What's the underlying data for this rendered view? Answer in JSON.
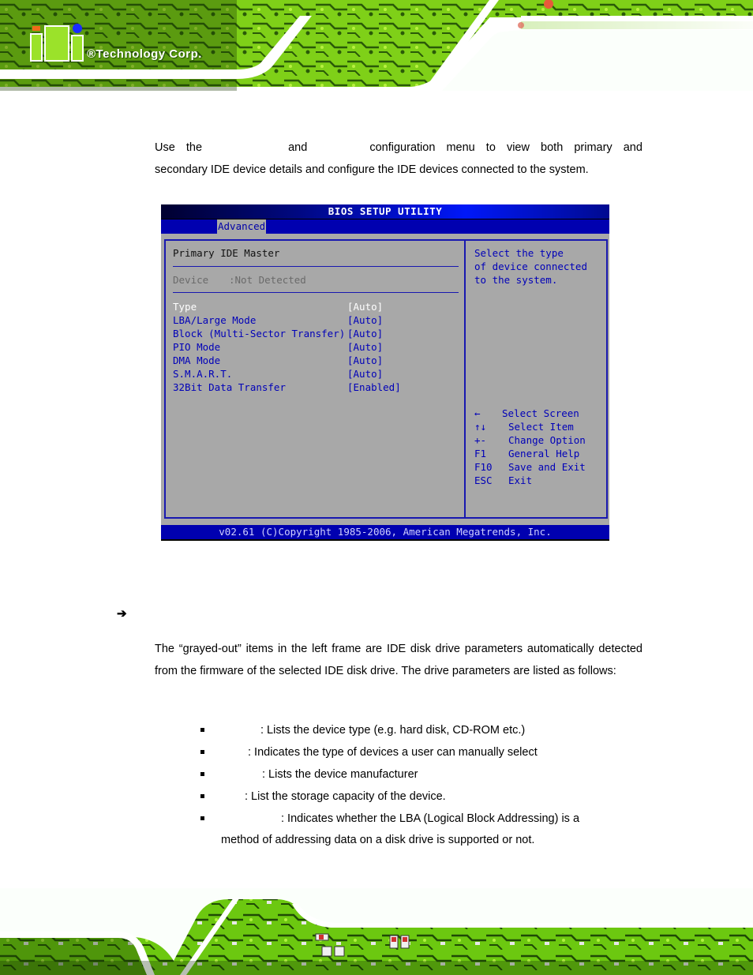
{
  "header": {
    "logo_text": "®Technology Corp."
  },
  "intro": {
    "line1_words": [
      "Use",
      "the",
      "and",
      "configuration",
      "menu",
      "to",
      "view",
      "both",
      "primary",
      "and"
    ],
    "line2": "secondary IDE device details and configure the IDE devices connected to the system."
  },
  "bios": {
    "title": "BIOS SETUP UTILITY",
    "active_tab": "Advanced",
    "section_title": "Primary IDE Master",
    "device_label": "Device",
    "device_value": ":Not Detected",
    "settings": [
      {
        "label": "Type",
        "value": "[Auto]",
        "selected": true
      },
      {
        "label": "LBA/Large Mode",
        "value": "[Auto]",
        "selected": false
      },
      {
        "label": "Block (Multi-Sector Transfer)",
        "value": "[Auto]",
        "selected": false
      },
      {
        "label": "PIO Mode",
        "value": "[Auto]",
        "selected": false
      },
      {
        "label": "DMA Mode",
        "value": "[Auto]",
        "selected": false
      },
      {
        "label": "S.M.A.R.T.",
        "value": "[Auto]",
        "selected": false
      },
      {
        "label": "32Bit Data Transfer",
        "value": "[Enabled]",
        "selected": false
      }
    ],
    "help_text": [
      "Select the type",
      "of device connected",
      "to the system."
    ],
    "keys": [
      {
        "key": "←",
        "action": "Select Screen"
      },
      {
        "key": "↑↓",
        "action": "Select Item"
      },
      {
        "key": "+-",
        "action": "Change Option"
      },
      {
        "key": "F1",
        "action": "General Help"
      },
      {
        "key": "F10",
        "action": "Save and Exit"
      },
      {
        "key": "ESC",
        "action": "Exit"
      }
    ],
    "footer": "v02.61 (C)Copyright 1985-2006, American Megatrends, Inc."
  },
  "section_arrow": "➔",
  "paragraph": "The “grayed-out” items in the left frame are IDE disk drive parameters automatically detected from the firmware of the selected IDE disk drive. The drive parameters are listed as follows:",
  "bullets": [
    {
      "text": ": Lists the device type (e.g. hard disk, CD-ROM etc.)"
    },
    {
      "text": ": Indicates the type of devices a user can manually select"
    },
    {
      "text": ": Lists the device manufacturer"
    },
    {
      "text": ": List the storage capacity of the device."
    },
    {
      "text": ": Indicates whether the LBA (Logical Block Addressing) is a",
      "continuation": "method of addressing data on a disk drive is supported or not."
    }
  ],
  "colors": {
    "brand_green": "#9be22a",
    "bios_blue": "#0000b0",
    "bios_gray": "#a8a8a8"
  }
}
